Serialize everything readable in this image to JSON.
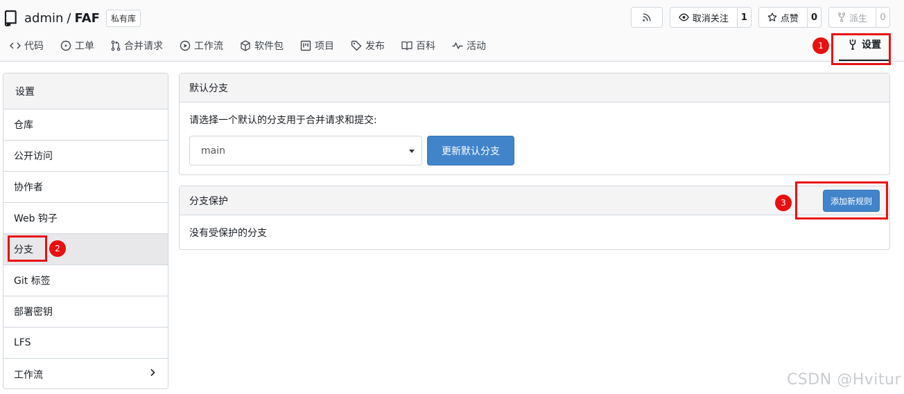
{
  "repo": {
    "owner": "admin",
    "separator": "/",
    "name": "FAF",
    "badge": "私有库"
  },
  "actions": {
    "unwatch_label": "取消关注",
    "unwatch_count": "1",
    "star_label": "点赞",
    "star_count": "0",
    "fork_label": "派生",
    "fork_count": "0"
  },
  "tabs": [
    {
      "label": "代码",
      "icon": "code-icon"
    },
    {
      "label": "工单",
      "icon": "issue-icon"
    },
    {
      "label": "合并请求",
      "icon": "pull-request-icon"
    },
    {
      "label": "工作流",
      "icon": "actions-icon"
    },
    {
      "label": "软件包",
      "icon": "package-icon"
    },
    {
      "label": "项目",
      "icon": "project-icon"
    },
    {
      "label": "发布",
      "icon": "tag-icon"
    },
    {
      "label": "百科",
      "icon": "book-icon"
    },
    {
      "label": "活动",
      "icon": "pulse-icon"
    }
  ],
  "settings_tab": {
    "label": "设置",
    "icon": "tools-icon"
  },
  "annotations": {
    "one": "1",
    "two": "2",
    "three": "3"
  },
  "sidebar": {
    "header": "设置",
    "items": [
      {
        "label": "仓库"
      },
      {
        "label": "公开访问"
      },
      {
        "label": "协作者"
      },
      {
        "label": "Web 钩子"
      },
      {
        "label": "分支"
      },
      {
        "label": "Git 标签"
      },
      {
        "label": "部署密钥"
      },
      {
        "label": "LFS"
      },
      {
        "label": "工作流"
      }
    ]
  },
  "default_branch": {
    "title": "默认分支",
    "description": "请选择一个默认的分支用于合并请求和提交:",
    "selected": "main",
    "button": "更新默认分支"
  },
  "branch_protection": {
    "title": "分支保护",
    "add_button": "添加新规则",
    "empty": "没有受保护的分支"
  },
  "watermark": "CSDN @Hvitur",
  "colors": {
    "primary": "#4184c9",
    "annotation_red": "#e81010",
    "border": "#d0d7de"
  }
}
